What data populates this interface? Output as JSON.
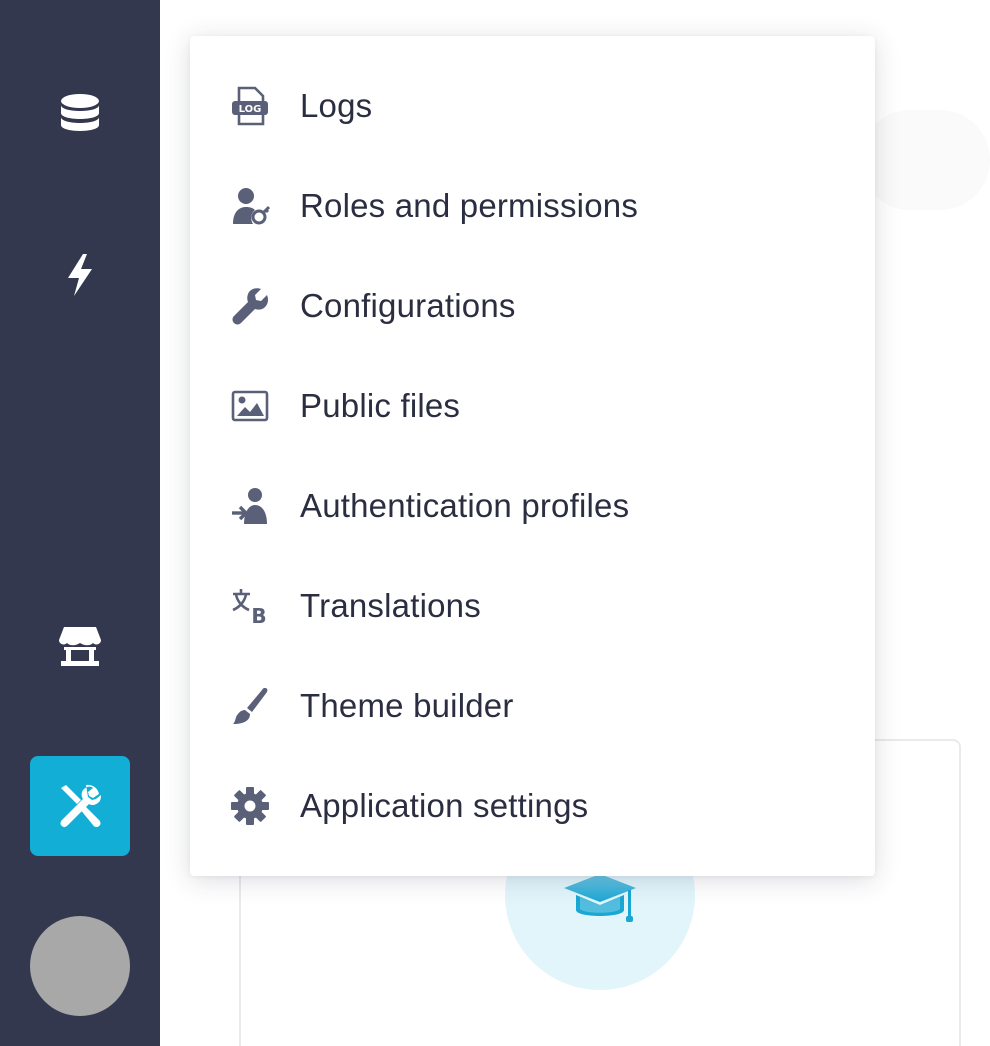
{
  "sidebar": {
    "items": [
      {
        "name": "database",
        "icon": "database-icon"
      },
      {
        "name": "flows",
        "icon": "lightning-icon"
      },
      {
        "name": "marketplace",
        "icon": "store-icon"
      },
      {
        "name": "tools",
        "icon": "tools-icon",
        "active": true
      }
    ],
    "colors": {
      "background": "#33384f",
      "active": "#12aed6"
    }
  },
  "menu": {
    "items": [
      {
        "label": "Logs",
        "icon": "log-file-icon"
      },
      {
        "label": "Roles and permissions",
        "icon": "user-key-icon"
      },
      {
        "label": "Configurations",
        "icon": "wrench-icon"
      },
      {
        "label": "Public files",
        "icon": "image-icon"
      },
      {
        "label": "Authentication profiles",
        "icon": "user-sign-in-icon"
      },
      {
        "label": "Translations",
        "icon": "translate-icon"
      },
      {
        "label": "Theme builder",
        "icon": "paint-brush-icon"
      },
      {
        "label": "Application settings",
        "icon": "gear-icon"
      }
    ]
  },
  "background": {
    "card_icon": "graduation-cap-icon",
    "accent": "#12aed6"
  }
}
